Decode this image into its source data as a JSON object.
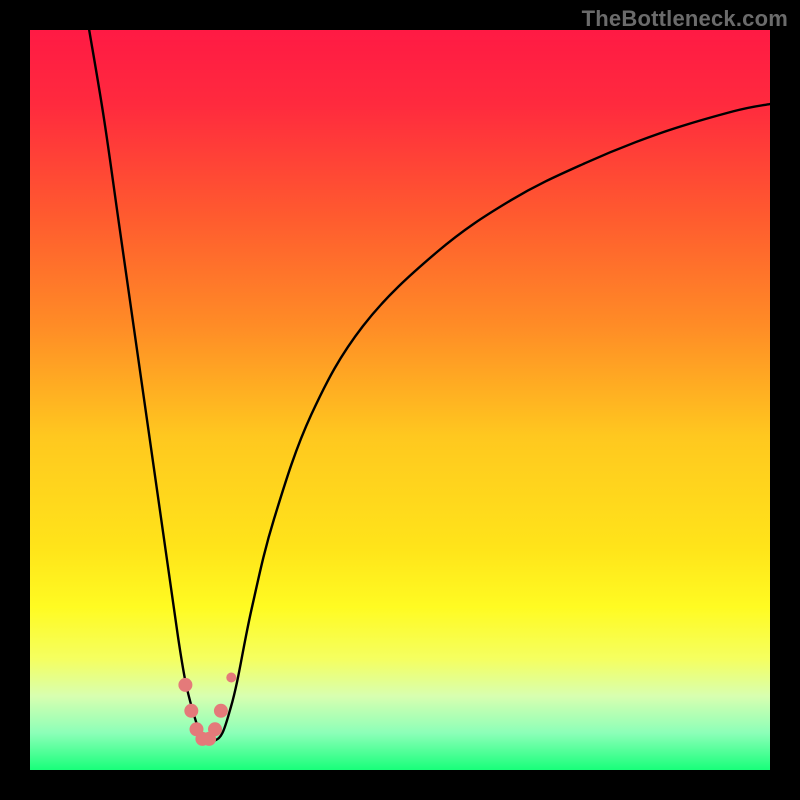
{
  "watermark": "TheBottleneck.com",
  "colors": {
    "frame": "#000000",
    "gradient_stops": [
      {
        "offset": 0.0,
        "color": "#ff1a44"
      },
      {
        "offset": 0.1,
        "color": "#ff2a3e"
      },
      {
        "offset": 0.25,
        "color": "#ff5a2f"
      },
      {
        "offset": 0.4,
        "color": "#ff8c26"
      },
      {
        "offset": 0.55,
        "color": "#ffc81f"
      },
      {
        "offset": 0.7,
        "color": "#ffe41a"
      },
      {
        "offset": 0.78,
        "color": "#fffb22"
      },
      {
        "offset": 0.85,
        "color": "#f5ff60"
      },
      {
        "offset": 0.9,
        "color": "#d8ffb0"
      },
      {
        "offset": 0.95,
        "color": "#8cffb8"
      },
      {
        "offset": 1.0,
        "color": "#18ff7a"
      }
    ],
    "curve_stroke": "#000000",
    "marker_fill": "#e47a7a",
    "marker_stroke": "#c95b5b"
  },
  "chart_data": {
    "type": "line",
    "title": "",
    "xlabel": "",
    "ylabel": "",
    "x_range": [
      0,
      100
    ],
    "y_range": [
      0,
      100
    ],
    "series": [
      {
        "name": "bottleneck-curve",
        "x": [
          8,
          10,
          12,
          14,
          16,
          18,
          20,
          21,
          22,
          23,
          24,
          25,
          26,
          27,
          28,
          30,
          33,
          38,
          45,
          55,
          65,
          75,
          85,
          95,
          100
        ],
        "y": [
          100,
          88,
          74,
          60,
          46,
          32,
          18,
          12,
          8,
          5,
          4,
          4,
          5,
          8,
          12,
          22,
          34,
          48,
          60,
          70,
          77,
          82,
          86,
          89,
          90
        ]
      }
    ],
    "markers": {
      "name": "highlight-dots",
      "x": [
        21.0,
        21.8,
        22.5,
        23.3,
        24.2,
        25.0,
        25.8,
        27.2
      ],
      "y": [
        11.5,
        8.0,
        5.5,
        4.2,
        4.2,
        5.5,
        8.0,
        12.5
      ],
      "r": [
        7,
        7,
        7,
        7,
        7,
        7,
        7,
        5
      ]
    }
  }
}
